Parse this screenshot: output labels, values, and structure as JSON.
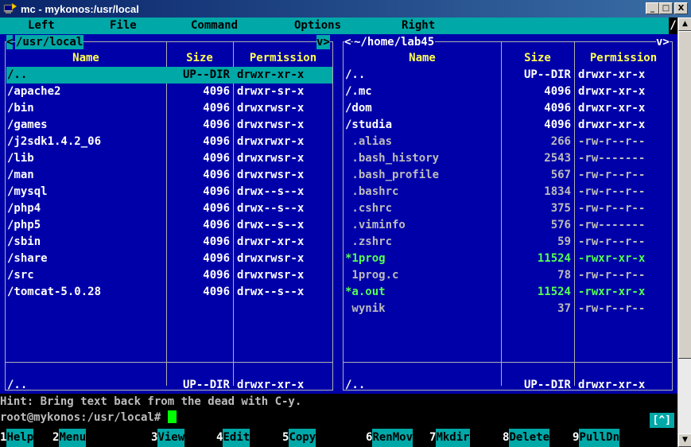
{
  "window": {
    "title": "mc - mykonos:/usr/local",
    "minimize": "_",
    "maximize": "□",
    "close": "X"
  },
  "menubar": {
    "left": "Left",
    "file": "File",
    "command": "Command",
    "options": "Options",
    "right": "Right",
    "end": "/"
  },
  "left_panel": {
    "path": "/usr/local",
    "corner_left": "<",
    "corner_right": "v>",
    "headers": {
      "name": "Name",
      "size": "Size",
      "perm": "Permission"
    },
    "rows": [
      {
        "name": "/..",
        "size": "UP--DIR",
        "perm": "drwxr-xr-x",
        "selected": true
      },
      {
        "name": "/apache2",
        "size": "4096",
        "perm": "drwxr-sr-x"
      },
      {
        "name": "/bin",
        "size": "4096",
        "perm": "drwxrwsr-x"
      },
      {
        "name": "/games",
        "size": "4096",
        "perm": "drwxrwsr-x"
      },
      {
        "name": "/j2sdk1.4.2_06",
        "size": "4096",
        "perm": "drwxrwxr-x"
      },
      {
        "name": "/lib",
        "size": "4096",
        "perm": "drwxrwsr-x"
      },
      {
        "name": "/man",
        "size": "4096",
        "perm": "drwxrwsr-x"
      },
      {
        "name": "/mysql",
        "size": "4096",
        "perm": "drwx--s--x"
      },
      {
        "name": "/php4",
        "size": "4096",
        "perm": "drwx--s--x"
      },
      {
        "name": "/php5",
        "size": "4096",
        "perm": "drwx--s--x"
      },
      {
        "name": "/sbin",
        "size": "4096",
        "perm": "drwxr-xr-x"
      },
      {
        "name": "/share",
        "size": "4096",
        "perm": "drwxrwsr-x"
      },
      {
        "name": "/src",
        "size": "4096",
        "perm": "drwxrwsr-x"
      },
      {
        "name": "/tomcat-5.0.28",
        "size": "4096",
        "perm": "drwx--s--x"
      }
    ],
    "status": {
      "name": "/..",
      "size": "UP--DIR",
      "perm": "drwxr-xr-x"
    }
  },
  "right_panel": {
    "path": "~/home/lab45",
    "corner_left": "<",
    "corner_right": "v>",
    "headers": {
      "name": "Name",
      "size": "Size",
      "perm": "Permission"
    },
    "rows": [
      {
        "name": "/..",
        "size": "UP--DIR",
        "perm": "drwxr-xr-x",
        "color": "white"
      },
      {
        "name": "/.mc",
        "size": "4096",
        "perm": "drwxr-xr-x",
        "color": "white"
      },
      {
        "name": "/dom",
        "size": "4096",
        "perm": "drwxr-xr-x",
        "color": "white"
      },
      {
        "name": "/studia",
        "size": "4096",
        "perm": "drwxr-xr-x",
        "color": "white"
      },
      {
        "name": " .alias",
        "size": "266",
        "perm": "-rw-r--r--",
        "color": "gray"
      },
      {
        "name": " .bash_history",
        "size": "2543",
        "perm": "-rw-------",
        "color": "gray"
      },
      {
        "name": " .bash_profile",
        "size": "567",
        "perm": "-rw-r--r--",
        "color": "gray"
      },
      {
        "name": " .bashrc",
        "size": "1834",
        "perm": "-rw-r--r--",
        "color": "gray"
      },
      {
        "name": " .cshrc",
        "size": "375",
        "perm": "-rw-r--r--",
        "color": "gray"
      },
      {
        "name": " .viminfo",
        "size": "576",
        "perm": "-rw-------",
        "color": "gray"
      },
      {
        "name": " .zshrc",
        "size": "59",
        "perm": "-rw-r--r--",
        "color": "gray"
      },
      {
        "name": "*1prog",
        "size": "11524",
        "perm": "-rwxr-xr-x",
        "color": "green"
      },
      {
        "name": " 1prog.c",
        "size": "78",
        "perm": "-rw-r--r--",
        "color": "gray"
      },
      {
        "name": "*a.out",
        "size": "11524",
        "perm": "-rwxr-xr-x",
        "color": "green"
      },
      {
        "name": " wynik",
        "size": "37",
        "perm": "-rw-r--r--",
        "color": "gray"
      }
    ],
    "status": {
      "name": "/..",
      "size": "UP--DIR",
      "perm": "drwxr-xr-x"
    }
  },
  "hint": "Hint: Bring text back from the dead with C-y.",
  "prompt": "root@mykonos:/usr/local# ",
  "updown": "[^]",
  "fkeys": [
    {
      "num": "1",
      "label": "Help"
    },
    {
      "num": "2",
      "label": "Menu"
    },
    {
      "num": "3",
      "label": "View"
    },
    {
      "num": "4",
      "label": "Edit"
    },
    {
      "num": "5",
      "label": "Copy"
    },
    {
      "num": "6",
      "label": "RenMov"
    },
    {
      "num": "7",
      "label": "Mkdir"
    },
    {
      "num": "8",
      "label": "Delete"
    },
    {
      "num": "9",
      "label": "PullDn"
    }
  ],
  "colors": {
    "panel_bg": "#0000a8",
    "cyan": "#00a8a8",
    "header_yellow": "#ffff54",
    "exec_green": "#54ff54",
    "file_gray": "#bcbcbc"
  }
}
